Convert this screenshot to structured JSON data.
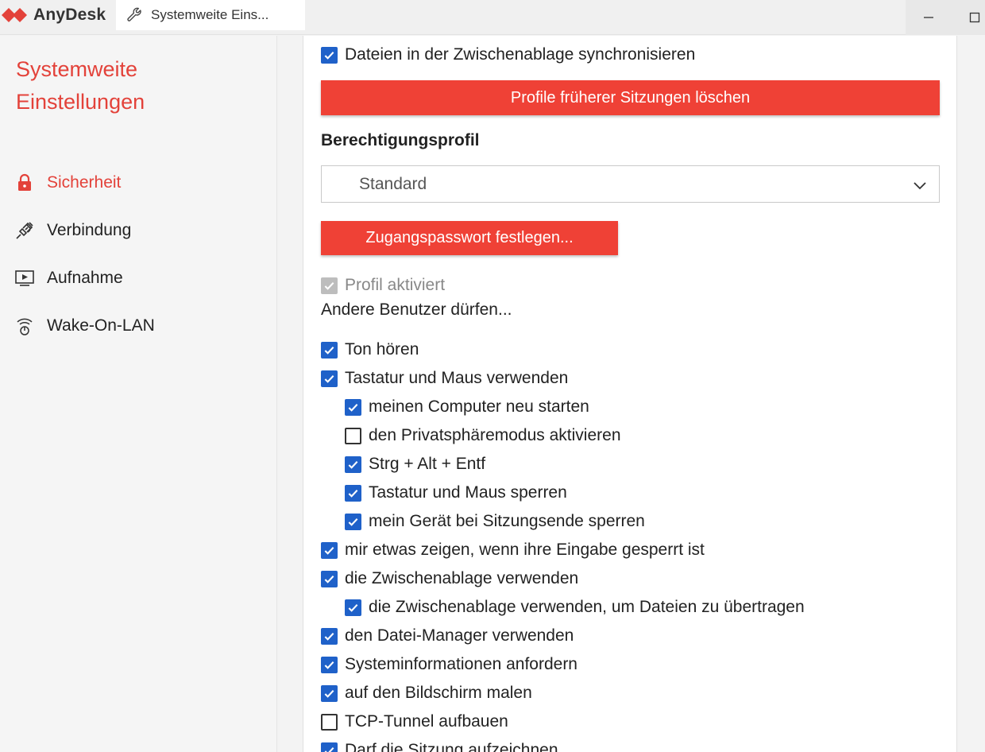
{
  "app": {
    "name": "AnyDesk",
    "brand_color": "#e3423a"
  },
  "tab": {
    "label": "Systemweite Eins...",
    "icon": "wrench-icon"
  },
  "sidebar": {
    "title_line1": "Systemweite",
    "title_line2": "Einstellungen",
    "items": [
      {
        "label": "Sicherheit",
        "icon": "lock-icon",
        "active": true
      },
      {
        "label": "Verbindung",
        "icon": "plug-icon",
        "active": false
      },
      {
        "label": "Aufnahme",
        "icon": "screen-play-icon",
        "active": false
      },
      {
        "label": "Wake-On-LAN",
        "icon": "wifi-power-icon",
        "active": false
      }
    ]
  },
  "main": {
    "sync_files_label": "Dateien in der Zwischenablage synchronisieren",
    "sync_files_checked": true,
    "delete_profiles_button": "Profile früherer Sitzungen löschen",
    "permission_heading": "Berechtigungsprofil",
    "permission_select_value": "Standard",
    "set_password_button": "Zugangspasswort festlegen...",
    "profile_active_label": "Profil aktiviert",
    "others_allowed_text": "Andere Benutzer dürfen...",
    "permissions": [
      {
        "label": "Ton hören",
        "checked": true,
        "indent": 0
      },
      {
        "label": "Tastatur und Maus verwenden",
        "checked": true,
        "indent": 0
      },
      {
        "label": "meinen Computer neu starten",
        "checked": true,
        "indent": 1
      },
      {
        "label": "den Privatsphäremodus aktivieren",
        "checked": false,
        "indent": 1
      },
      {
        "label": "Strg + Alt + Entf",
        "checked": true,
        "indent": 1
      },
      {
        "label": "Tastatur und Maus sperren",
        "checked": true,
        "indent": 1
      },
      {
        "label": "mein Gerät bei Sitzungsende sperren",
        "checked": true,
        "indent": 1
      },
      {
        "label": "mir etwas zeigen, wenn ihre Eingabe gesperrt ist",
        "checked": true,
        "indent": 0
      },
      {
        "label": "die Zwischenablage verwenden",
        "checked": true,
        "indent": 0
      },
      {
        "label": "die Zwischenablage verwenden, um Dateien zu übertragen",
        "checked": true,
        "indent": 1
      },
      {
        "label": "den Datei-Manager verwenden",
        "checked": true,
        "indent": 0
      },
      {
        "label": "Systeminformationen anfordern",
        "checked": true,
        "indent": 0
      },
      {
        "label": "auf den Bildschirm malen",
        "checked": true,
        "indent": 0
      },
      {
        "label": "TCP-Tunnel aufbauen",
        "checked": false,
        "indent": 0
      },
      {
        "label": "Darf die Sitzung aufzeichnen",
        "checked": true,
        "indent": 0
      }
    ]
  }
}
